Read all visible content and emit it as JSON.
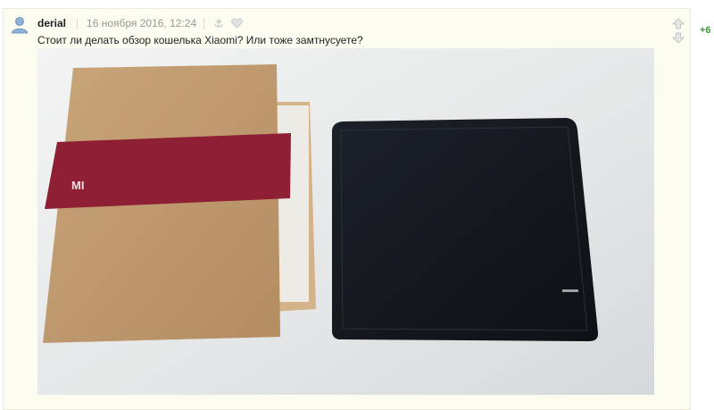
{
  "comment": {
    "username": "derial",
    "date": "16 ноября 2016, 12:24",
    "text": "Стоит ли делать обзор кошелька Xiaomi? Или тоже замтнусуете?",
    "score": "+6",
    "icons": {
      "avatar": "user-avatar-icon",
      "parent": "anchor-icon",
      "favorite": "heart-icon",
      "vote_up": "arrow-up-icon",
      "vote_down": "arrow-down-icon"
    }
  },
  "photo": {
    "box_logo": "MI"
  },
  "colors": {
    "comment_bg": "#fdfcf0",
    "score_positive": "#3a9a3a",
    "box_band": "#8e1f35",
    "wallet": "#14181d"
  }
}
